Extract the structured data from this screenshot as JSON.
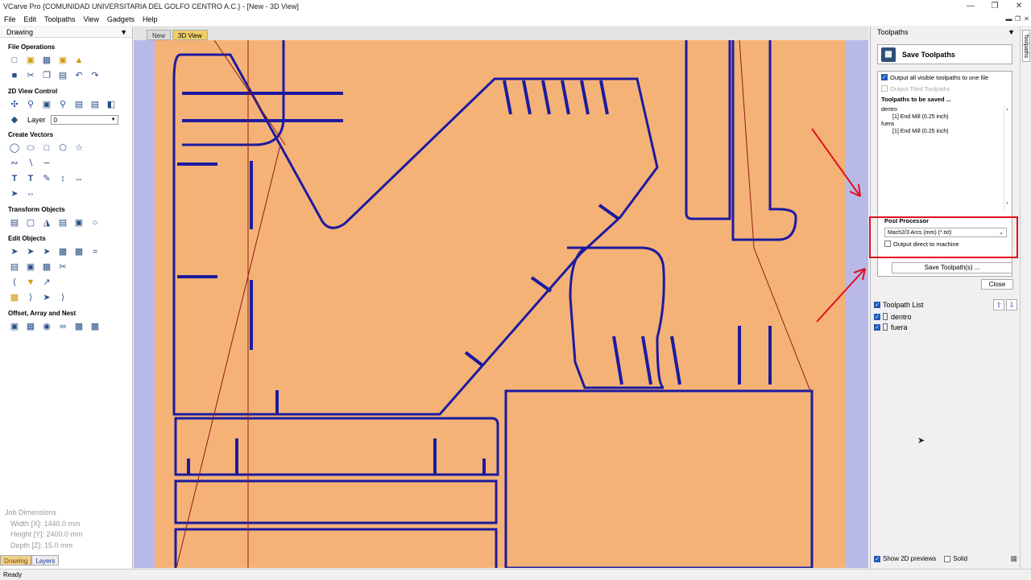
{
  "window": {
    "title": "VCarve Pro {COMUNIDAD UNIVERSITARIA DEL GOLFO CENTRO  A.C.} - [New - 3D View]"
  },
  "menu": [
    "File",
    "Edit",
    "Toolpaths",
    "View",
    "Gadgets",
    "Help"
  ],
  "left_panel": {
    "title": "Drawing",
    "sections": {
      "file_ops": "File Operations",
      "view_control": "2D View Control",
      "create_vectors": "Create Vectors",
      "transform": "Transform Objects",
      "edit": "Edit Objects",
      "offset": "Offset, Array and Nest"
    },
    "layer_label": "Layer",
    "layer_value": "0",
    "job_dims": {
      "title": "Job Dimensions",
      "width": "Width  [X]: 1440.0 mm",
      "height": "Height [Y]: 2400.0 mm",
      "depth": "Depth  [Z]: 15.0 mm"
    },
    "tabs": [
      "Drawing",
      "Layers"
    ]
  },
  "doc_tabs": [
    "New",
    "3D View"
  ],
  "right_panel": {
    "title": "Toolpaths",
    "save_title": "Save Toolpaths",
    "output_all": "Output all visible toolpaths to one file",
    "output_tiled": "Output Tiled Toolpaths",
    "to_be_saved": "Toolpaths to be saved ...",
    "toolpaths": [
      {
        "name": "dentro",
        "tool": "[1] End Mill (0.25 inch)"
      },
      {
        "name": "fuera",
        "tool": "[1] End Mill (0.25 inch)"
      }
    ],
    "post_processor_label": "Post Processor",
    "post_processor_value": "Mach2/3 Arcs (mm) (*.txt)",
    "output_direct": "Output direct to machine",
    "save_button": "Save Toolpath(s) ...",
    "close_button": "Close",
    "list_title": "Toolpath List",
    "list_items": [
      "dentro",
      "fuera"
    ],
    "show_2d": "Show 2D previews",
    "solid": "Solid"
  },
  "side_tab": "Toolpaths",
  "status": "Ready",
  "colors": {
    "wood": "#f5b277",
    "cut": "#1c1aa0",
    "highlight": "#e0101e",
    "tab_active": "#f2ce65"
  }
}
